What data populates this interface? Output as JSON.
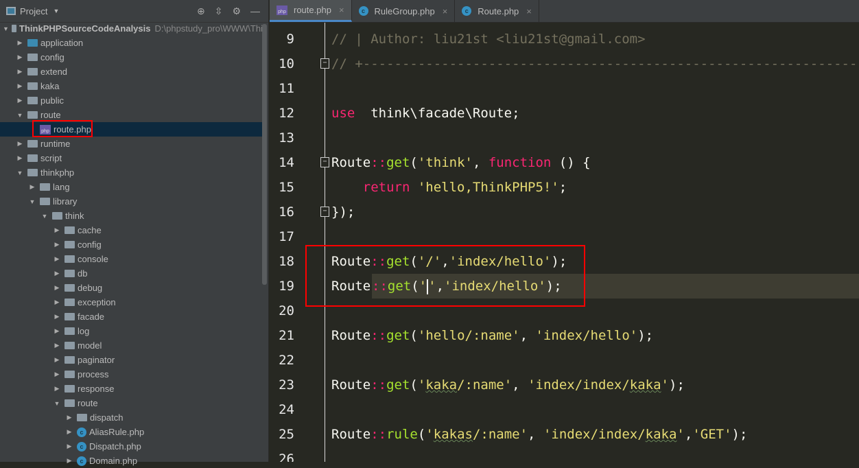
{
  "sidebar": {
    "title": "Project",
    "tree": [
      {
        "label": "ThinkPHPSourceCodeAnalysis",
        "path": "D:\\phpstudy_pro\\WWW\\Thi",
        "depth": 0,
        "open": true,
        "type": "folder",
        "root": true
      },
      {
        "label": "application",
        "depth": 1,
        "type": "folder-blue"
      },
      {
        "label": "config",
        "depth": 1,
        "type": "folder"
      },
      {
        "label": "extend",
        "depth": 1,
        "type": "folder"
      },
      {
        "label": "kaka",
        "depth": 1,
        "type": "folder"
      },
      {
        "label": "public",
        "depth": 1,
        "type": "folder"
      },
      {
        "label": "route",
        "depth": 1,
        "type": "folder",
        "open": true
      },
      {
        "label": "route.php",
        "depth": 2,
        "type": "php",
        "selected": true,
        "leaf": true
      },
      {
        "label": "runtime",
        "depth": 1,
        "type": "folder"
      },
      {
        "label": "script",
        "depth": 1,
        "type": "folder"
      },
      {
        "label": "thinkphp",
        "depth": 1,
        "type": "folder",
        "open": true
      },
      {
        "label": "lang",
        "depth": 2,
        "type": "folder"
      },
      {
        "label": "library",
        "depth": 2,
        "type": "folder",
        "open": true
      },
      {
        "label": "think",
        "depth": 3,
        "type": "folder",
        "open": true
      },
      {
        "label": "cache",
        "depth": 4,
        "type": "folder"
      },
      {
        "label": "config",
        "depth": 4,
        "type": "folder"
      },
      {
        "label": "console",
        "depth": 4,
        "type": "folder"
      },
      {
        "label": "db",
        "depth": 4,
        "type": "folder"
      },
      {
        "label": "debug",
        "depth": 4,
        "type": "folder"
      },
      {
        "label": "exception",
        "depth": 4,
        "type": "folder"
      },
      {
        "label": "facade",
        "depth": 4,
        "type": "folder"
      },
      {
        "label": "log",
        "depth": 4,
        "type": "folder"
      },
      {
        "label": "model",
        "depth": 4,
        "type": "folder"
      },
      {
        "label": "paginator",
        "depth": 4,
        "type": "folder"
      },
      {
        "label": "process",
        "depth": 4,
        "type": "folder"
      },
      {
        "label": "response",
        "depth": 4,
        "type": "folder"
      },
      {
        "label": "route",
        "depth": 4,
        "type": "folder",
        "open": true
      },
      {
        "label": "dispatch",
        "depth": 5,
        "type": "folder"
      },
      {
        "label": "AliasRule.php",
        "depth": 5,
        "type": "class"
      },
      {
        "label": "Dispatch.php",
        "depth": 5,
        "type": "class"
      },
      {
        "label": "Domain.php",
        "depth": 5,
        "type": "class"
      }
    ]
  },
  "tabs": [
    {
      "label": "route.php",
      "icon": "php",
      "active": true
    },
    {
      "label": "RuleGroup.php",
      "icon": "class"
    },
    {
      "label": "Route.php",
      "icon": "class"
    }
  ],
  "editor": {
    "lines": [
      {
        "n": "9",
        "tokens": [
          [
            "cm",
            "// | Author: liu21st <liu21st@gmail.com>"
          ]
        ]
      },
      {
        "n": "10",
        "fold": true,
        "tokens": [
          [
            "cm",
            "// +----------------------------------------------------------------"
          ]
        ]
      },
      {
        "n": "11",
        "tokens": []
      },
      {
        "n": "12",
        "tokens": [
          [
            "kw",
            "use"
          ],
          [
            "",
            "  think\\facade\\Route;"
          ]
        ]
      },
      {
        "n": "13",
        "tokens": []
      },
      {
        "n": "14",
        "fold": true,
        "tokens": [
          [
            "",
            "Route"
          ],
          [
            "kw",
            "::"
          ],
          [
            "fn",
            "get"
          ],
          [
            "",
            "("
          ],
          [
            "st",
            "'think'"
          ],
          [
            "",
            ", "
          ],
          [
            "kw",
            "function"
          ],
          [
            "",
            " () {"
          ]
        ]
      },
      {
        "n": "15",
        "tokens": [
          [
            "",
            "    "
          ],
          [
            "kw",
            "return"
          ],
          [
            "",
            " "
          ],
          [
            "st",
            "'hello,ThinkPHP5!'"
          ],
          [
            "",
            ";"
          ]
        ]
      },
      {
        "n": "16",
        "fold": true,
        "tokens": [
          [
            "",
            "});"
          ]
        ]
      },
      {
        "n": "17",
        "tokens": []
      },
      {
        "n": "18",
        "tokens": [
          [
            "",
            "Route"
          ],
          [
            "kw",
            "::"
          ],
          [
            "fn",
            "get"
          ],
          [
            "",
            "("
          ],
          [
            "st",
            "'/'"
          ],
          [
            "",
            ","
          ],
          [
            "st",
            "'index/hello'"
          ],
          [
            "",
            ");"
          ]
        ]
      },
      {
        "n": "19",
        "current": true,
        "tokens": [
          [
            "",
            "Route"
          ],
          [
            "kw",
            "::"
          ],
          [
            "fn",
            "get"
          ],
          [
            "",
            "("
          ],
          [
            "st",
            "'"
          ],
          [
            "caret",
            ""
          ],
          [
            "st",
            "'"
          ],
          [
            "",
            ","
          ],
          [
            "st",
            "'index/hello'"
          ],
          [
            "",
            ");"
          ]
        ]
      },
      {
        "n": "20",
        "tokens": []
      },
      {
        "n": "21",
        "tokens": [
          [
            "",
            "Route"
          ],
          [
            "kw",
            "::"
          ],
          [
            "fn",
            "get"
          ],
          [
            "",
            "("
          ],
          [
            "st",
            "'hello/:name'"
          ],
          [
            "",
            ", "
          ],
          [
            "st",
            "'index/hello'"
          ],
          [
            "",
            ");"
          ]
        ]
      },
      {
        "n": "22",
        "tokens": []
      },
      {
        "n": "23",
        "tokens": [
          [
            "",
            "Route"
          ],
          [
            "kw",
            "::"
          ],
          [
            "fn",
            "get"
          ],
          [
            "",
            "("
          ],
          [
            "st",
            "'"
          ],
          [
            "stq",
            "kaka"
          ],
          [
            "st",
            "/:name'"
          ],
          [
            "",
            ", "
          ],
          [
            "st",
            "'index/index/"
          ],
          [
            "stq",
            "kaka"
          ],
          [
            "st",
            "'"
          ],
          [
            "",
            ");"
          ]
        ]
      },
      {
        "n": "24",
        "tokens": []
      },
      {
        "n": "25",
        "tokens": [
          [
            "",
            "Route"
          ],
          [
            "kw",
            "::"
          ],
          [
            "fn",
            "rule"
          ],
          [
            "",
            "("
          ],
          [
            "st",
            "'"
          ],
          [
            "stq",
            "kakas"
          ],
          [
            "st",
            "/:name'"
          ],
          [
            "",
            ", "
          ],
          [
            "st",
            "'index/index/"
          ],
          [
            "stq",
            "kaka"
          ],
          [
            "st",
            "'"
          ],
          [
            "",
            ","
          ],
          [
            "st",
            "'GET'"
          ],
          [
            "",
            ");"
          ]
        ]
      },
      {
        "n": "26",
        "tokens": []
      }
    ]
  }
}
